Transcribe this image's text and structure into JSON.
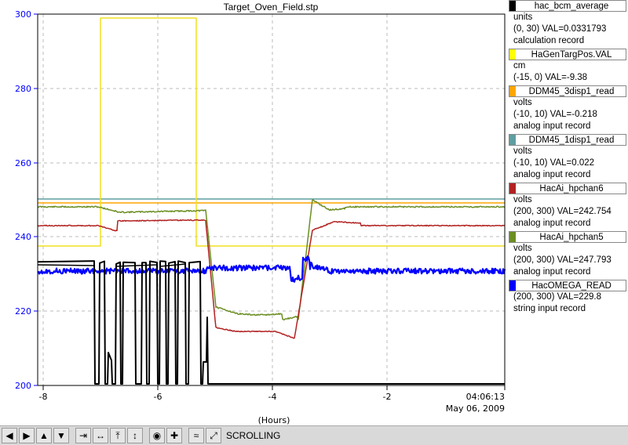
{
  "title": "Target_Oven_Field.stp",
  "x_axis": {
    "label": "(Hours)",
    "ticks": [
      "-8",
      "-6",
      "-4",
      "-2"
    ],
    "end_time": "04:06:13",
    "end_date": "May 06, 2009"
  },
  "y_axis": {
    "ticks": [
      "200",
      "220",
      "240",
      "260",
      "280",
      "300"
    ],
    "color": "#0000ff"
  },
  "pvs": [
    {
      "name": "hac_bcm_average",
      "color": "#000000",
      "lines": [
        "units",
        "(0, 30) VAL=0.0331793",
        "calculation record"
      ]
    },
    {
      "name": "HaGenTargPos.VAL",
      "color": "#ffff00",
      "lines": [
        "cm",
        "(-15, 0) VAL=-9.38"
      ]
    },
    {
      "name": "DDM45_3disp1_read",
      "color": "#ffa500",
      "lines": [
        "volts",
        "(-10, 10) VAL=-0.218",
        "analog input record"
      ]
    },
    {
      "name": "DDM45_1disp1_read",
      "color": "#5f9ea0",
      "lines": [
        "volts",
        "(-10, 10) VAL=0.022",
        "analog input record"
      ]
    },
    {
      "name": "HacAi_hpchan6",
      "color": "#b22222",
      "lines": [
        "volts",
        "(200, 300) VAL=242.754",
        "analog input record"
      ]
    },
    {
      "name": "HacAi_hpchan5",
      "color": "#6b8e23",
      "lines": [
        "volts",
        "(200, 300) VAL=247.793",
        "analog input record"
      ]
    },
    {
      "name": "HacOMEGA_READ",
      "color": "#0000ff",
      "lines": [
        "(200, 300) VAL=229.8",
        "string input record"
      ]
    }
  ],
  "toolbar": {
    "buttons": [
      {
        "name": "scroll-left-button",
        "glyph": "◀"
      },
      {
        "name": "scroll-right-button",
        "glyph": "▶"
      },
      {
        "name": "scroll-up-button",
        "glyph": "▲"
      },
      {
        "name": "scroll-down-button",
        "glyph": "▼"
      },
      {
        "name": "zoom-in-x-button",
        "glyph": "⇥"
      },
      {
        "name": "zoom-out-x-button",
        "glyph": "↔"
      },
      {
        "name": "zoom-in-y-button",
        "glyph": "⤒"
      },
      {
        "name": "zoom-out-y-button",
        "glyph": "↕"
      },
      {
        "name": "stop-scroll-button",
        "glyph": "◉"
      },
      {
        "name": "config-button",
        "glyph": "✚"
      },
      {
        "name": "scroll-mode-button",
        "glyph": "≈"
      },
      {
        "name": "expand-button",
        "glyph": "⤢"
      }
    ],
    "status": "SCROLLING"
  }
}
